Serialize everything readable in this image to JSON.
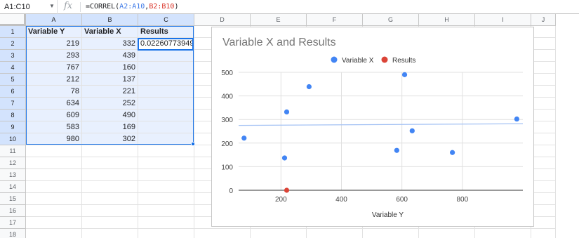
{
  "formula_bar": {
    "name_box": "A1:C10",
    "fx_label": "fx",
    "formula": {
      "prefix": "=CORREL(",
      "range1": "A2:A10",
      "comma": ",",
      "range2": "B2:B10",
      "suffix": ")"
    }
  },
  "grid": {
    "columns": [
      "A",
      "B",
      "C",
      "D",
      "E",
      "F",
      "G",
      "H",
      "I",
      "J"
    ],
    "rows": [
      "1",
      "2",
      "3",
      "4",
      "5",
      "6",
      "7",
      "8",
      "9",
      "10",
      "11",
      "12",
      "13",
      "14",
      "15",
      "16",
      "17",
      "18"
    ],
    "headers": [
      "Variable Y",
      "Variable X",
      "Results"
    ],
    "data": [
      [
        "219",
        "332",
        "0.02260773949"
      ],
      [
        "293",
        "439",
        ""
      ],
      [
        "767",
        "160",
        ""
      ],
      [
        "212",
        "137",
        ""
      ],
      [
        "78",
        "221",
        ""
      ],
      [
        "634",
        "252",
        ""
      ],
      [
        "609",
        "490",
        ""
      ],
      [
        "583",
        "169",
        ""
      ],
      [
        "980",
        "302",
        ""
      ]
    ]
  },
  "chart_data": {
    "type": "scatter",
    "title": "Variable X and Results",
    "xlabel": "Variable Y",
    "ylabel": "",
    "xlim": [
      60,
      1000
    ],
    "ylim": [
      0,
      500
    ],
    "x_ticks": [
      "200",
      "400",
      "600",
      "800"
    ],
    "y_ticks": [
      "0",
      "100",
      "200",
      "300",
      "400",
      "500"
    ],
    "grid": true,
    "legend_position": "top",
    "series": [
      {
        "name": "Variable X",
        "color": "#4285f4",
        "points": [
          [
            219,
            332
          ],
          [
            293,
            439
          ],
          [
            767,
            160
          ],
          [
            212,
            137
          ],
          [
            78,
            221
          ],
          [
            634,
            252
          ],
          [
            609,
            490
          ],
          [
            583,
            169
          ],
          [
            980,
            302
          ]
        ]
      },
      {
        "name": "Results",
        "color": "#db4437",
        "points": [
          [
            219,
            0.02260773949
          ]
        ]
      }
    ],
    "trendline": {
      "series": "Variable X",
      "color": "#a4c2f4",
      "from": [
        60,
        275
      ],
      "to": [
        1000,
        282
      ]
    }
  }
}
